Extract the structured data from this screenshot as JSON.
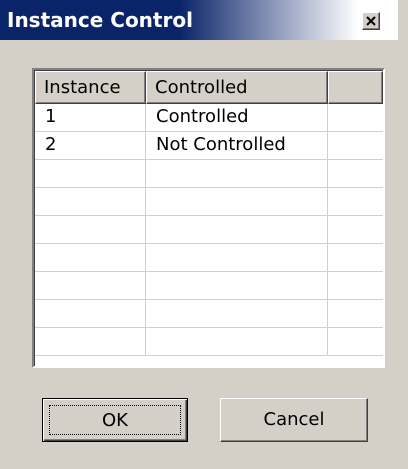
{
  "window": {
    "title": "Instance Control",
    "close_icon": "close-icon"
  },
  "list": {
    "columns": [
      "Instance",
      "Controlled",
      ""
    ],
    "rows": [
      [
        "1",
        "Controlled",
        ""
      ],
      [
        "2",
        "Not Controlled",
        ""
      ],
      [
        "",
        "",
        ""
      ],
      [
        "",
        "",
        ""
      ],
      [
        "",
        "",
        ""
      ],
      [
        "",
        "",
        ""
      ],
      [
        "",
        "",
        ""
      ],
      [
        "",
        "",
        ""
      ],
      [
        "",
        "",
        ""
      ]
    ]
  },
  "buttons": {
    "ok_label": "OK",
    "cancel_label": "Cancel"
  },
  "colors": {
    "title_bar_start": "#0a246a",
    "title_bar_end": "#ffffff",
    "dialog_face": "#d4d0c8",
    "list_background": "#ffffff"
  }
}
